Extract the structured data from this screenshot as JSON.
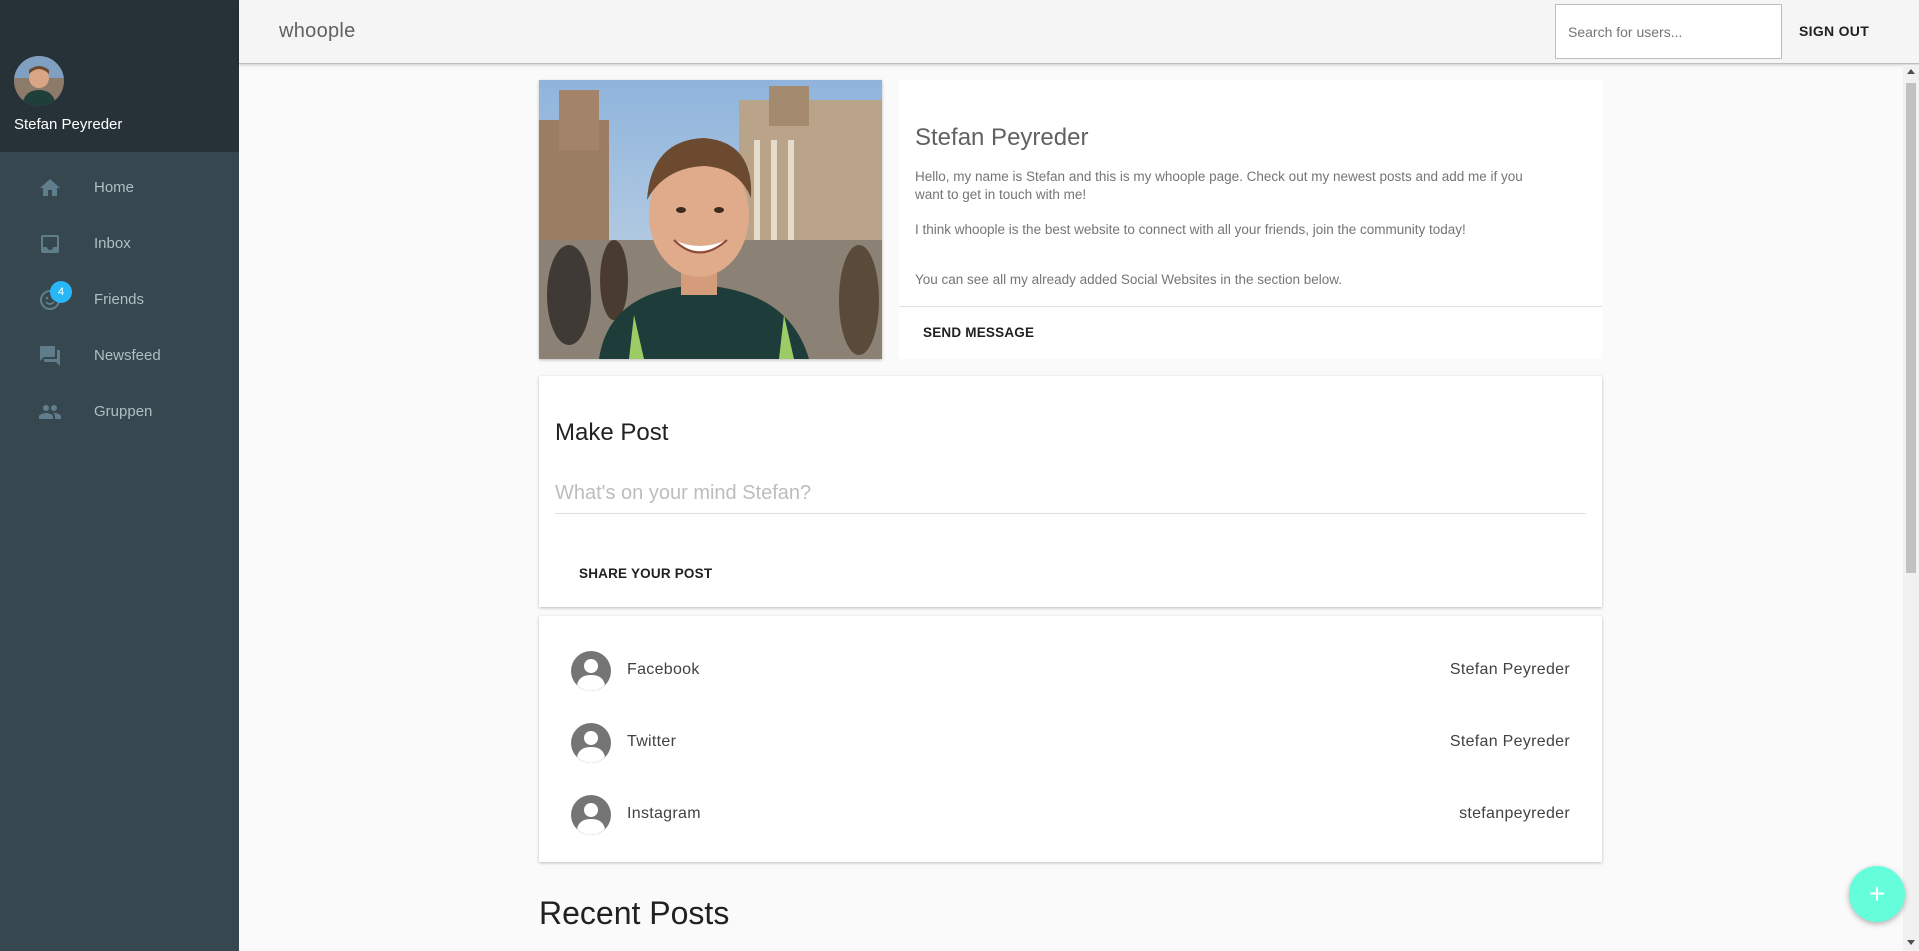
{
  "app": {
    "title": "whoople"
  },
  "sidebar": {
    "user_name": "Stefan Peyreder",
    "items": [
      {
        "label": "Home",
        "icon": "home-icon"
      },
      {
        "label": "Inbox",
        "icon": "inbox-icon"
      },
      {
        "label": "Friends",
        "icon": "face-icon",
        "badge": "4"
      },
      {
        "label": "Newsfeed",
        "icon": "forum-icon"
      },
      {
        "label": "Gruppen",
        "icon": "people-icon"
      }
    ]
  },
  "topbar": {
    "search_placeholder": "Search for users...",
    "signout_label": "SIGN OUT"
  },
  "profile": {
    "name": "Stefan Peyreder",
    "bio_1": "Hello, my name is Stefan and this is my whoople page. Check out my newest posts and add me if you want to get in touch with me!",
    "bio_2": "I think whoople is the best website to connect with all your friends, join the community today!",
    "bio_3": "You can see all my already added Social Websites in the section below.",
    "send_message_label": "SEND MESSAGE"
  },
  "make_post": {
    "title": "Make Post",
    "placeholder": "What's on your mind Stefan?",
    "share_label": "SHARE YOUR POST"
  },
  "social": [
    {
      "site": "Facebook",
      "handle": "Stefan Peyreder"
    },
    {
      "site": "Twitter",
      "handle": "Stefan Peyreder"
    },
    {
      "site": "Instagram",
      "handle": "stefanpeyreder"
    }
  ],
  "recent_posts_title": "Recent Posts",
  "fab_label": "+",
  "colors": {
    "sidebar": "#37474f",
    "sidebar_header": "#263238",
    "badge": "#29b6f6",
    "fab": "#64ffda"
  }
}
